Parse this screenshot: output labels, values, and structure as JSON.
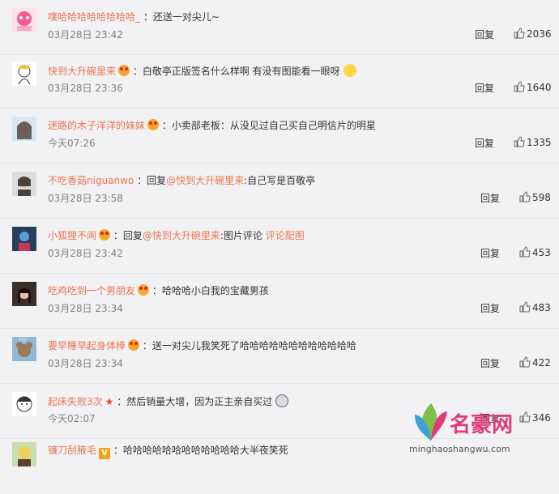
{
  "comments": [
    {
      "user": "噗哈哈哈哈哈哈哈哈_",
      "sep": " ：",
      "text": "还送一对尖儿~",
      "time": "03月28日 23:42",
      "reply": "回复",
      "likes": "2036",
      "badge": false
    },
    {
      "user": "快到大升碗里来",
      "sep": " ：",
      "text": "白敬亭正版签名什么样啊 有没有图能看一眼呀",
      "time": "03月28日 23:36",
      "reply": "回复",
      "likes": "1640",
      "badge": true
    },
    {
      "user": "迷路的木子洋洋的妹妹",
      "sep": " ：",
      "text": "小卖部老板：从没见过自己买自己明信片的明星",
      "time": "今天07:26",
      "reply": "回复",
      "likes": "1335",
      "badge": true
    },
    {
      "user": "不吃香菇niguanwo",
      "sep": " ：",
      "reply_prefix": "回复",
      "mention": "@快到大升碗里来",
      "text": ":自己写是百敬亭",
      "time": "03月28日 23:58",
      "reply": "回复",
      "likes": "598",
      "badge": false
    },
    {
      "user": "小狐狸不闹",
      "sep": " ：",
      "reply_prefix": "回复",
      "mention": "@快到大升碗里来",
      "text": ":图片评论 ",
      "link": "评论配图",
      "time": "03月28日 23:42",
      "reply": "回复",
      "likes": "453",
      "badge": true
    },
    {
      "user": "吃鸡吃到一个男朋友",
      "sep": " ：",
      "text": "哈哈哈小白我的宝藏男孩",
      "time": "03月28日 23:34",
      "reply": "回复",
      "likes": "483",
      "badge": true
    },
    {
      "user": "要早睡早起身体棒",
      "sep": " ：",
      "text": "送一对尖儿我笑死了哈哈哈哈哈哈哈哈哈哈哈哈",
      "time": "03月28日 23:34",
      "reply": "回复",
      "likes": "422",
      "badge": true
    },
    {
      "user": "起床失败3次",
      "sep": " ：",
      "text": "然后销量大增，因为正主亲自买过",
      "time": "今天02:07",
      "reply": "回复",
      "likes": "346",
      "badge": false
    },
    {
      "user": "镰刀刮腋毛",
      "sep": " ：",
      "text": "哈哈哈哈哈哈哈哈哈哈哈哈大半夜笑死",
      "time": "",
      "reply": "",
      "likes": "",
      "badge": false
    }
  ],
  "watermark": {
    "name": "名豪网",
    "url": "minghaoshangwu.com"
  },
  "colors": {
    "username": "#eb7350",
    "background": "#f2f2f5"
  }
}
